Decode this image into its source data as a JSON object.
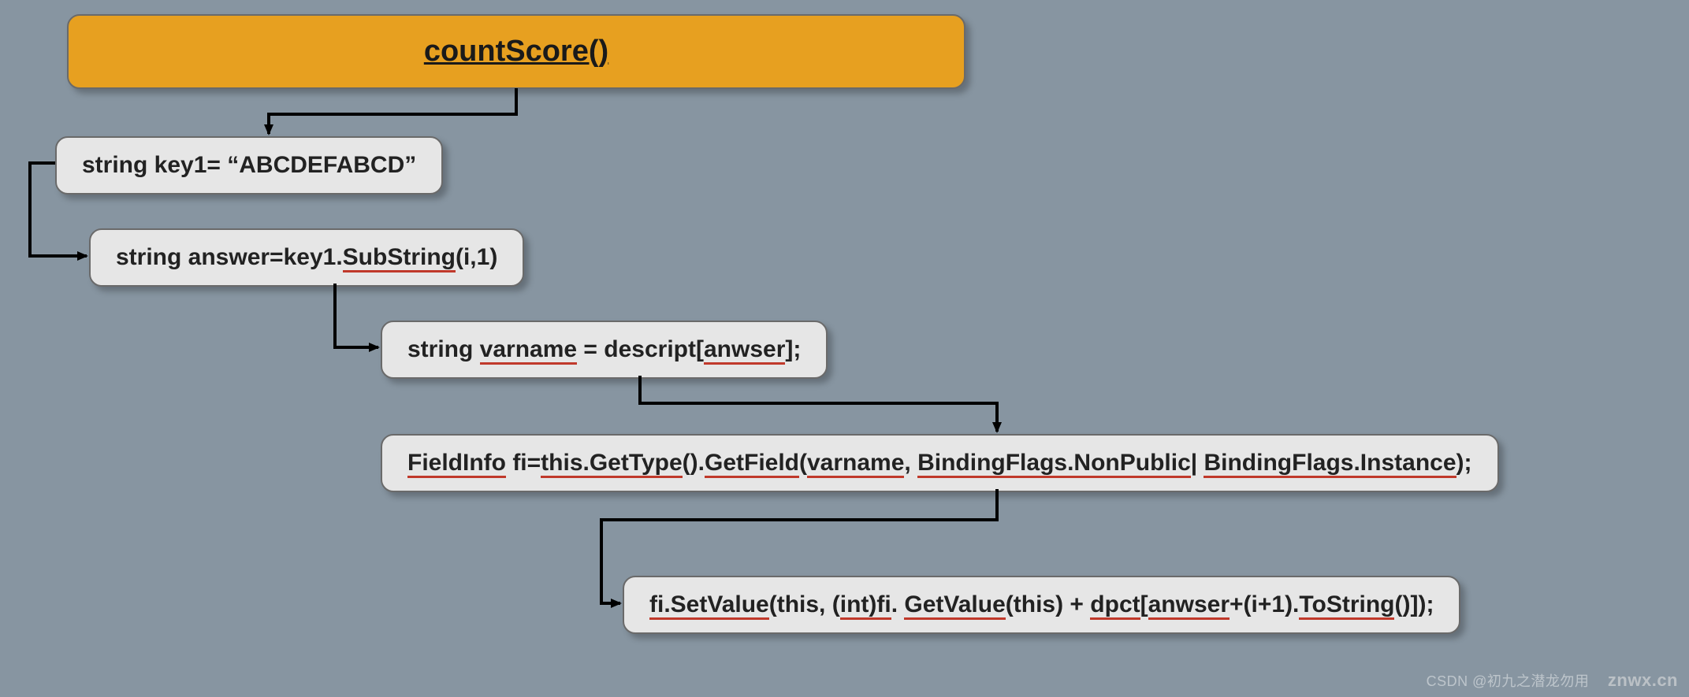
{
  "flow": {
    "start": {
      "label": "countScore()"
    },
    "n1": {
      "pre1": "string key1= ",
      "quote": "“ABCDEFABCD”"
    },
    "n2": {
      "pre": "string answer=key1.",
      "sq1": "SubString",
      "post": "(i,1)"
    },
    "n3": {
      "pre": "string ",
      "sq1": "varname",
      "mid": " = descript[",
      "sq2": "anwser",
      "post": "];"
    },
    "n4": {
      "sq1": "FieldInfo",
      "t1": " fi=",
      "sq2": "this.GetType",
      "t2": "().",
      "sq3": "GetField",
      "t3": "(",
      "sq4": "varname",
      "t4": ", ",
      "sq5": "BindingFlags.NonPublic",
      "t5": "| ",
      "sq6": "BindingFlags.Instance",
      "t6": ");"
    },
    "n5": {
      "sq1": "fi.SetValue",
      "t1": "(this, (",
      "sq2": "int)fi",
      "t2": ". ",
      "sq3": "GetValue",
      "t3": "(this) + ",
      "sq4": "dpct",
      "t4": "[",
      "sq5": "anwser",
      "t5": "+(i+1).",
      "sq6": "ToString",
      "t6": "()]);"
    }
  },
  "watermark": {
    "left": "CSDN @初九之潜龙勿用",
    "right": "znwx.cn"
  }
}
